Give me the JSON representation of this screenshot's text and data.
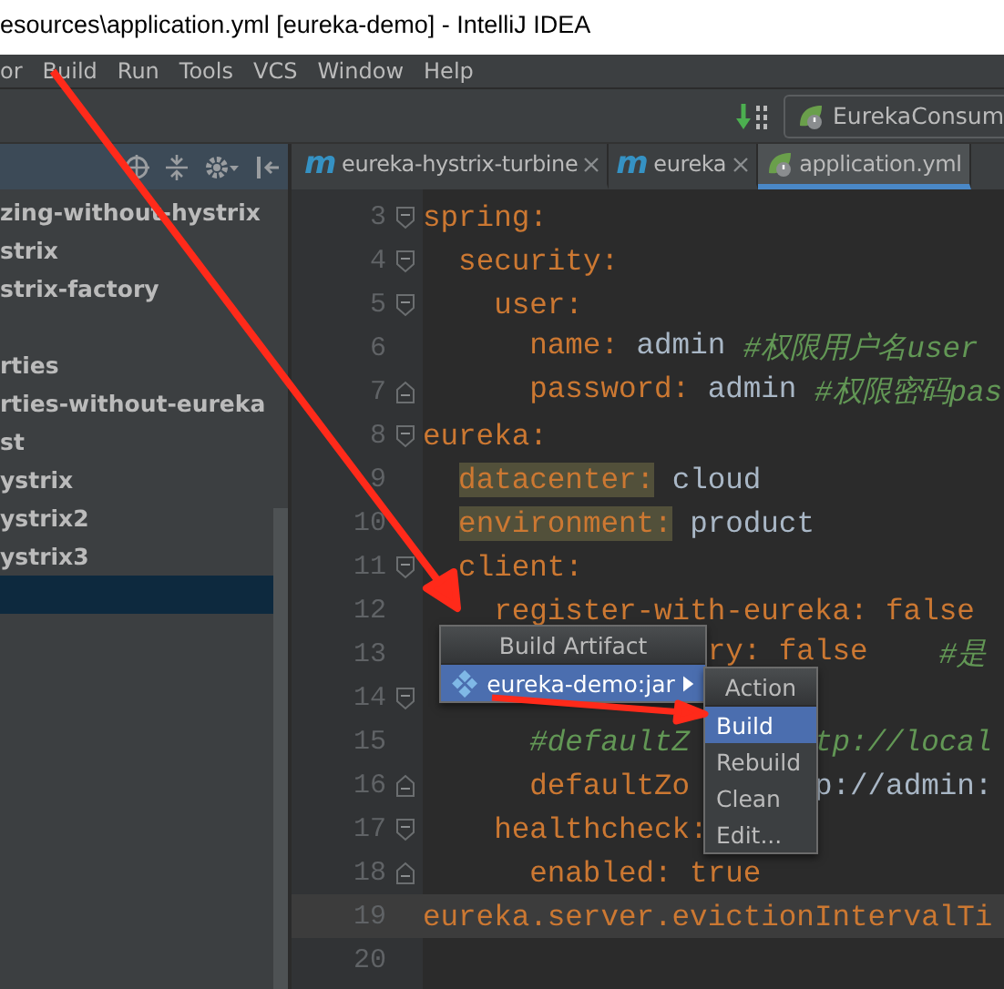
{
  "window": {
    "title": "esources\\application.yml [eureka-demo] - IntelliJ IDEA"
  },
  "menu": [
    "or",
    "Build",
    "Run",
    "Tools",
    "VCS",
    "Window",
    "Help"
  ],
  "toolbar": {
    "run_config": "EurekaConsum"
  },
  "tree": [
    {
      "label": "zing-without-hystrix",
      "selected": false
    },
    {
      "label": "strix",
      "selected": false
    },
    {
      "label": "strix-factory",
      "selected": false
    },
    {
      "selected": false
    },
    {
      "label": "rties",
      "selected": false
    },
    {
      "label": "rties-without-eureka",
      "selected": false
    },
    {
      "label": "st",
      "selected": false
    },
    {
      "label": "ystrix",
      "selected": false
    },
    {
      "label": "ystrix2",
      "selected": false
    },
    {
      "label": "ystrix3",
      "selected": false
    },
    {
      "selected": true
    }
  ],
  "tabs": [
    {
      "label": "eureka-hystrix-turbine",
      "kind": "module",
      "icon_letter": "m",
      "selected": false
    },
    {
      "label": "eureka",
      "kind": "module",
      "icon_letter": "m",
      "selected": false
    },
    {
      "label": "application.yml",
      "kind": "config",
      "selected": true
    }
  ],
  "editor": {
    "lines": [
      {
        "number": "3",
        "kind": "fold-start",
        "tokens": [
          {
            "text": "spring:",
            "kind": "key"
          }
        ]
      },
      {
        "number": "4",
        "kind": "fold-start",
        "tokens": [
          {
            "text": "  security:",
            "kind": "key"
          }
        ]
      },
      {
        "number": "5",
        "kind": "fold-start",
        "tokens": [
          {
            "text": "    user:",
            "kind": "key"
          }
        ]
      },
      {
        "number": "6",
        "kind": "plain",
        "tokens": [
          {
            "text": "      name:",
            "kind": "key"
          },
          {
            "text": " admin",
            "kind": "value"
          },
          {
            "text": " #权限用户名user",
            "kind": "comment"
          }
        ]
      },
      {
        "number": "7",
        "kind": "fold-end",
        "tokens": [
          {
            "text": "      password:",
            "kind": "key"
          },
          {
            "text": " admin",
            "kind": "value"
          },
          {
            "text": " #权限密码pas",
            "kind": "comment"
          }
        ]
      },
      {
        "number": "8",
        "kind": "fold-start",
        "tokens": [
          {
            "text": "eureka:",
            "kind": "key"
          }
        ]
      },
      {
        "number": "9",
        "kind": "plain",
        "tokens": [
          {
            "text": "  datacenter:",
            "kind": "key",
            "highlighted": true
          },
          {
            "text": " cloud",
            "kind": "value"
          }
        ]
      },
      {
        "number": "10",
        "kind": "plain",
        "tokens": [
          {
            "text": "  environment:",
            "kind": "key",
            "highlighted": true
          },
          {
            "text": " product",
            "kind": "value"
          }
        ]
      },
      {
        "number": "11",
        "kind": "fold-start",
        "tokens": [
          {
            "text": "  client:",
            "kind": "key"
          }
        ]
      },
      {
        "number": "12",
        "kind": "plain",
        "tokens": [
          {
            "text": "    register-with-eureka: false",
            "kind": "key"
          }
        ]
      },
      {
        "number": "13",
        "kind": "plain",
        "tokens": [
          {
            "text": "                ry: false",
            "kind": "key"
          },
          {
            "text": "    #是",
            "kind": "comment"
          }
        ]
      },
      {
        "number": "14",
        "kind": "fold-start"
      },
      {
        "number": "15",
        "kind": "plain",
        "tokens": [
          {
            "text": "      #defaultZ",
            "kind": "comment"
          },
          {
            "text": "       tp://local",
            "kind": "comment"
          }
        ]
      },
      {
        "number": "16",
        "kind": "fold-end",
        "tokens": [
          {
            "text": "      defaultZo",
            "kind": "key"
          },
          {
            "text": "       p://admin:",
            "kind": "value"
          }
        ]
      },
      {
        "number": "17",
        "kind": "fold-start",
        "tokens": [
          {
            "text": "    healthcheck:",
            "kind": "key"
          }
        ]
      },
      {
        "number": "18",
        "kind": "fold-end",
        "tokens": [
          {
            "text": "      enabled: true",
            "kind": "key"
          }
        ]
      },
      {
        "number": "19",
        "kind": "plain",
        "current": true,
        "tokens": [
          {
            "text": "eureka.server.evictionIntervalTi",
            "kind": "key"
          }
        ]
      },
      {
        "number": "20",
        "kind": "plain"
      }
    ]
  },
  "artifact_popup": {
    "title": "Build Artifact",
    "items": [
      {
        "label": "eureka-demo:jar",
        "selected": true
      }
    ]
  },
  "action_popup": {
    "title": "Action",
    "items": [
      {
        "label": "Build",
        "selected": true
      },
      {
        "label": "Rebuild",
        "selected": false
      },
      {
        "label": "Clean",
        "selected": false
      },
      {
        "label": "Edit...",
        "selected": false
      }
    ]
  }
}
